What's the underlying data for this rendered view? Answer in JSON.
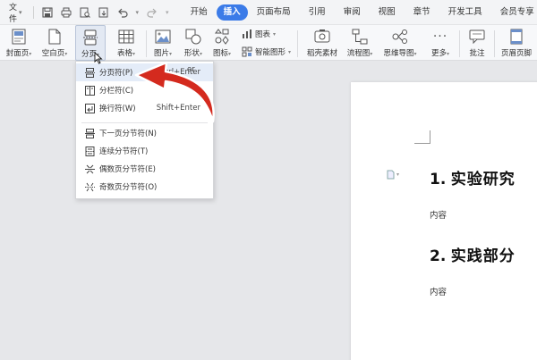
{
  "menubar": {
    "file_label": "文件",
    "tabs": [
      {
        "label": "开始"
      },
      {
        "label": "插入",
        "active": true
      },
      {
        "label": "页面布局"
      },
      {
        "label": "引用"
      },
      {
        "label": "审阅"
      },
      {
        "label": "视图"
      },
      {
        "label": "章节"
      },
      {
        "label": "开发工具"
      },
      {
        "label": "会员专享"
      }
    ]
  },
  "ribbon": {
    "cover_page": "封面页",
    "blank_page": "空白页",
    "break": "分页",
    "table": "表格",
    "picture": "图片",
    "shape": "形状",
    "icon": "图标",
    "chart": "图表",
    "smart_graphic": "智能图形",
    "docer_material": "稻壳素材",
    "flowchart": "流程图",
    "mindmap": "思维导图",
    "more": "更多",
    "comment": "批注",
    "header_footer": "页眉页脚",
    "partial_label": "er"
  },
  "dropdown": {
    "items": [
      {
        "label": "分页符(P)",
        "shortcut": "Ctrl+Enter",
        "icon": "page-break-icon"
      },
      {
        "label": "分栏符(C)",
        "shortcut": "",
        "icon": "column-break-icon"
      },
      {
        "label": "换行符(W)",
        "shortcut": "Shift+Enter",
        "icon": "line-break-icon"
      },
      {
        "label": "下一页分节符(N)",
        "shortcut": "",
        "icon": "next-page-section-icon"
      },
      {
        "label": "连续分节符(T)",
        "shortcut": "",
        "icon": "continuous-section-icon"
      },
      {
        "label": "偶数页分节符(E)",
        "shortcut": "",
        "icon": "even-page-section-icon"
      },
      {
        "label": "奇数页分节符(O)",
        "shortcut": "",
        "icon": "odd-page-section-icon"
      }
    ]
  },
  "document": {
    "heading1_num": "1.",
    "heading1_text": "实验研究",
    "para1": "内容",
    "heading2_num": "2.",
    "heading2_text": "实践部分",
    "para2": "内容"
  },
  "colors": {
    "accent": "#3b7be8",
    "arrow": "#d42a1e",
    "hover": "#e4ecf8"
  }
}
